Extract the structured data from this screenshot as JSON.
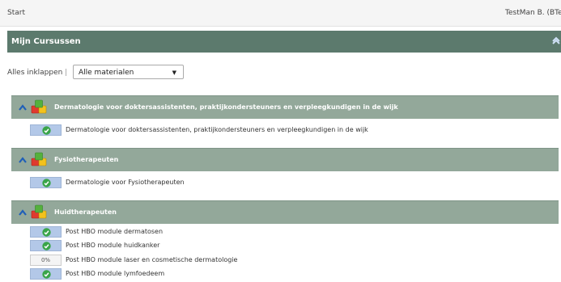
{
  "topbar": {
    "start": "Start",
    "user": "TestMan B. (BTe"
  },
  "panel": {
    "title": "Mijn Cursussen"
  },
  "filters": {
    "collapse_all": "Alles inklappen",
    "separator": "|",
    "material_select": "Alle materialen"
  },
  "groups": [
    {
      "title": "Dermatologie voor doktersassistenten, praktijkondersteuners en verpleegkundigen in de wijk",
      "courses": [
        {
          "name": "Dermatologie voor doktersassistenten, praktijkondersteuners en verpleegkundigen in de wijk",
          "status": "completed"
        }
      ]
    },
    {
      "title": "Fysiotherapeuten",
      "courses": [
        {
          "name": "Dermatologie voor Fysiotherapeuten",
          "status": "completed"
        }
      ]
    },
    {
      "title": "Huidtherapeuten",
      "courses": [
        {
          "name": "Post HBO module dermatosen",
          "status": "completed"
        },
        {
          "name": "Post HBO module huidkanker",
          "status": "completed"
        },
        {
          "name": "Post HBO module laser en cosmetische dermatologie",
          "status": "progress",
          "progress_label": "0%"
        },
        {
          "name": "Post HBO module lymfoedeem",
          "status": "completed"
        }
      ]
    }
  ],
  "colors": {
    "panel_header": "#5c7a6d",
    "group_header": "#93a89a",
    "status_fill": "#b3c8e8",
    "check_green": "#3aa54a"
  }
}
